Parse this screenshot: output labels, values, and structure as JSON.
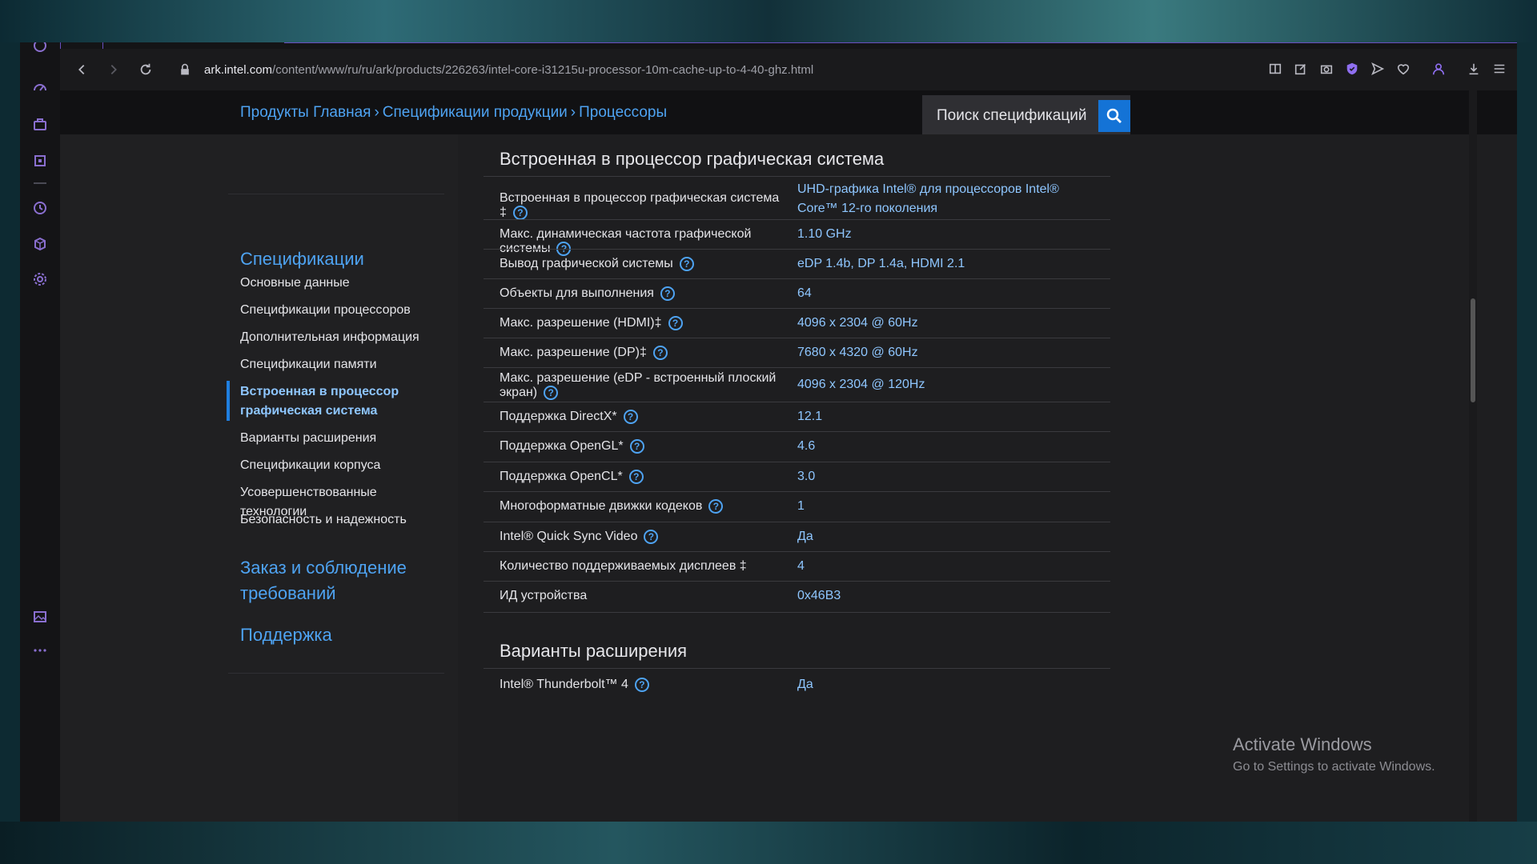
{
  "browser": {
    "url_domain": "ark.intel.com",
    "url_path": "/content/www/ru/ru/ark/products/226263/intel-core-i31215u-processor-10m-cache-up-to-4-40-ghz.html"
  },
  "breadcrumb": {
    "items": [
      "Продукты Главная",
      "Спецификации продукции",
      "Процессоры"
    ],
    "separator": "›"
  },
  "search": {
    "placeholder": "Поиск спецификаций"
  },
  "sidebar": {
    "heading_specs": "Спецификации",
    "items": [
      "Основные данные",
      "Спецификации процессоров",
      "Дополнительная информация",
      "Спецификации памяти",
      "Встроенная в процессор графическая система",
      "Варианты расширения",
      "Спецификации корпуса",
      "Усовершенствованные технологии",
      "Безопасность и надежность"
    ],
    "heading_order": "Заказ и соблюдение требований",
    "heading_support": "Поддержка"
  },
  "content": {
    "section_graphics": "Встроенная в процессор графическая система",
    "rows": [
      {
        "label": "Встроенная в процессор графическая система ‡",
        "value": "UHD-графика Intel® для процессоров Intel® Core™ 12-го поколения"
      },
      {
        "label": "Макс. динамическая частота графической системы",
        "value": "1.10 GHz"
      },
      {
        "label": "Вывод графической системы",
        "value": "eDP 1.4b, DP 1.4a, HDMI 2.1"
      },
      {
        "label": "Объекты для выполнения",
        "value": "64"
      },
      {
        "label": "Макс. разрешение (HDMI)‡",
        "value": "4096 x 2304 @ 60Hz"
      },
      {
        "label": "Макс. разрешение (DP)‡",
        "value": "7680 x 4320 @ 60Hz"
      },
      {
        "label": "Макс. разрешение (eDP - встроенный плоский экран)",
        "value": "4096 x 2304 @ 120Hz"
      },
      {
        "label": "Поддержка DirectX*",
        "value": "12.1"
      },
      {
        "label": "Поддержка OpenGL*",
        "value": "4.6"
      },
      {
        "label": "Поддержка OpenCL*",
        "value": "3.0"
      },
      {
        "label": "Многоформатные движки кодеков",
        "value": "1"
      },
      {
        "label": "Intel® Quick Sync Video",
        "value": "Да"
      },
      {
        "label": "Количество поддерживаемых дисплеев ‡",
        "value": "4"
      },
      {
        "label": "ИД устройства",
        "value": "0x46B3"
      }
    ],
    "section_expansion": "Варианты расширения",
    "expansion_rows": [
      {
        "label": "Intel® Thunderbolt™ 4",
        "value": "Да"
      }
    ],
    "help_glyph": "?"
  },
  "watermark": {
    "title": "Activate Windows",
    "subtitle": "Go to Settings to activate Windows."
  }
}
